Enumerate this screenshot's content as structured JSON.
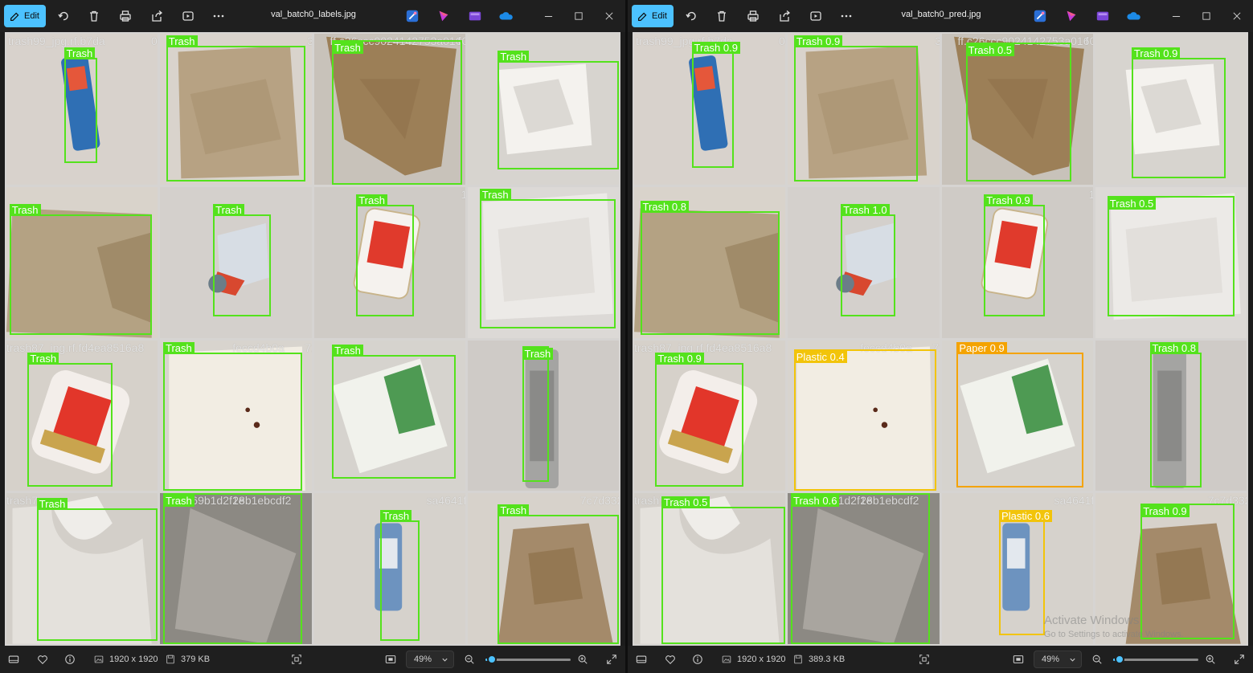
{
  "colors": {
    "accent": "#4cc2ff",
    "box_trash": "#54e21c",
    "box_plastic": "#f2c40a",
    "box_paper": "#f4a300"
  },
  "toolbar": {
    "edit_label": "Edit",
    "icons": [
      "rotate-icon",
      "delete-icon",
      "print-icon",
      "share-icon",
      "slideshow-icon",
      "more-icon"
    ]
  },
  "apps": [
    "designer-icon",
    "clipchamp-icon",
    "video-editor-icon",
    "onedrive-icon"
  ],
  "windows": [
    {
      "title": "val_batch0_labels.jpg",
      "dimensions": "1920 x 1920",
      "size": "379 KB",
      "zoom": "49%",
      "zoom_level": 0.08,
      "filenames": [
        "trash99_jpg.rf.b7da",
        "09",
        "3a",
        "ff.c26ccc9024142753a0160ccb5d06f5ee1b613",
        "f",
        "8babbd9d5e6c0ea",
        "b00c4bd18323c80e4667007",
        "1",
        "trash87_jpg.rf.fd4ea8516a8",
        "feccd4b0a",
        "71fcc8c2596b4a71751f2b5",
        "rf.c2bb51ac2b960371352",
        "trash7",
        "fa5b769b1d2f1e",
        "28b1ebcdf2",
        "sa4641ff30a67f",
        "7c7d332f7e8"
      ],
      "cells": [
        [
          {
            "label": "Trash"
          }
        ],
        [
          {
            "label": "Trash"
          }
        ],
        [
          {
            "label": "Trash"
          }
        ],
        [
          {
            "label": "Trash"
          }
        ],
        [
          {
            "label": "Trash"
          }
        ],
        [
          {
            "label": "Trash"
          }
        ],
        [
          {
            "label": "Trash"
          }
        ],
        [
          {
            "label": "Trash"
          }
        ],
        [
          {
            "label": "Trash"
          }
        ],
        [
          {
            "label": "Trash"
          }
        ],
        [
          {
            "label": "Trash"
          }
        ],
        [
          {
            "label": "Trash"
          }
        ],
        [
          {
            "label": "Trash"
          }
        ],
        [
          {
            "label": "Trash"
          }
        ],
        [
          {
            "label": "Trash"
          }
        ],
        [
          {
            "label": "Trash"
          }
        ]
      ]
    },
    {
      "title": "val_batch0_pred.jpg",
      "dimensions": "1920 x 1920",
      "size": "389.3 KB",
      "zoom": "49%",
      "zoom_level": 0.08,
      "filenames": [
        "trash99_jpg.rf.b7da",
        "09",
        "3a",
        "ff.c26ccc9024142753a0160ccb5d06f5ee1b613",
        "f",
        "8babbd9d5e6c0ea",
        "b00c4bd18323c80e4667007",
        "1",
        "trash87_jpg.rf.fd4ea8516a8",
        "feccd4b0a",
        "71fcc8c2596b4a71751f2b5",
        "rf.c2bb51ac2b960371352",
        "trash7",
        "fa5b769b1d2f1e",
        "28b1ebcdf2",
        "sa4641ff30a67f",
        "7c7d332f7e8"
      ],
      "cells": [
        [
          {
            "label": "Trash 0.9"
          }
        ],
        [
          {
            "label": "Trash 0.9"
          }
        ],
        [
          {
            "label": "Trash 0.5"
          }
        ],
        [
          {
            "label": "Trash 0.9"
          }
        ],
        [
          {
            "label": "Trash 0.8"
          }
        ],
        [
          {
            "label": "Trash 1.0"
          }
        ],
        [
          {
            "label": "Trash 0.9"
          }
        ],
        [
          {
            "label": "Trash 0.5"
          }
        ],
        [
          {
            "label": "Trash 0.9"
          }
        ],
        [
          {
            "label": "Plastic 0.4",
            "class": "plastic"
          }
        ],
        [
          {
            "label": "Paper 0.9",
            "class": "paper"
          }
        ],
        [
          {
            "label": "Trash 0.8"
          }
        ],
        [
          {
            "label": "Trash 0.5"
          }
        ],
        [
          {
            "label": "Trash 0.6"
          }
        ],
        [
          {
            "label": "Plastic 0.6",
            "class": "plastic"
          }
        ],
        [
          {
            "label": "Trash 0.9"
          }
        ]
      ]
    }
  ],
  "watermark": {
    "title": "Activate Windows",
    "subtitle": "Go to Settings to activate Windows."
  }
}
